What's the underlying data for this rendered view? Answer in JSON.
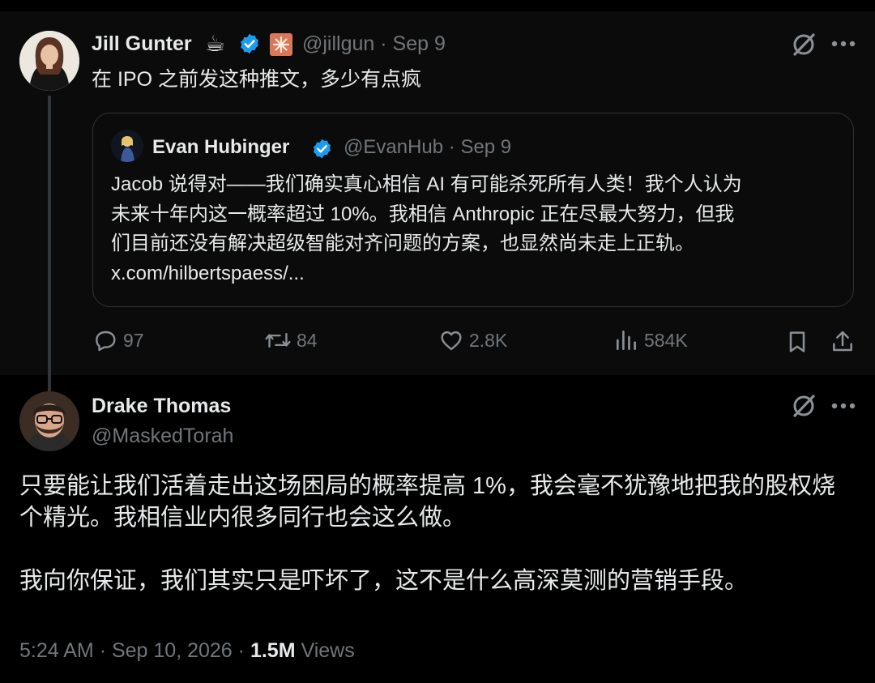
{
  "parent_tweet": {
    "author_name": "Jill Gunter",
    "emoji_badge": "☕",
    "handle": "@jillgun",
    "date": "Sep 9",
    "separator": "·",
    "text": "在 IPO 之前发这种推文，多少有点疯",
    "quote": {
      "author_name": "Evan Hubinger",
      "handle": "@EvanHub",
      "date": "Sep 9",
      "separator": "·",
      "lines": [
        "Jacob 说得对——我们确实真心相信 AI 有可能杀死所有人类！我个人认为",
        "未来十年内这一概率超过 10%。我相信 Anthropic 正在尽最大努力，但我",
        "们目前还没有解决超级智能对齐问题的方案，也显然尚未走上正轨。",
        "x.com/hilbertspaess/..."
      ]
    },
    "stats": {
      "replies": "97",
      "reposts": "84",
      "likes": "2.8K",
      "views": "584K"
    }
  },
  "main_tweet": {
    "author_name": "Drake Thomas",
    "handle": "@MaskedTorah",
    "paragraphs": [
      "只要能让我们活着走出这场困局的概率提高 1%，我会毫不犹豫地把我的股权烧个精光。我相信业内很多同行也会这么做。",
      "我向你保证，我们其实只是吓坏了，这不是什么高深莫测的营销手段。"
    ],
    "time": "5:24 AM",
    "date": "Sep 10, 2026",
    "separator": "·",
    "views_count": "1.5M",
    "views_label": "Views"
  },
  "colors": {
    "background": "#000000",
    "text": "#e7e9ea",
    "muted": "#71767b",
    "verified": "#1d9bf0",
    "border": "#2f3336"
  }
}
